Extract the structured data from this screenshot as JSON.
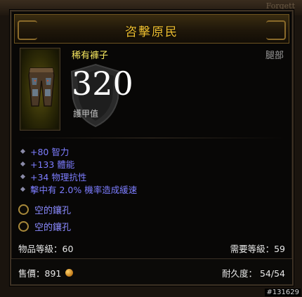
{
  "background": {
    "corner_text": "Forgett"
  },
  "tooltip": {
    "title": "咨擊原民",
    "item_name": "稀有褲子",
    "slot": "腿部",
    "armor_value": "320",
    "armor_label": "護甲值",
    "stats": [
      "+80 智力",
      "+133 體能",
      "+34 物理抗性",
      "擊中有 2.0% 機率造成緩速"
    ],
    "sockets": [
      "空的鑲孔",
      "空的鑲孔"
    ],
    "item_level": "物品等級：60",
    "required_level": "需要等級：59",
    "sell_price": "售價：891",
    "durability": "耐久度： 54/54",
    "colors": {
      "title": "#f0c030",
      "item_name": "#f8e860",
      "stat": "#7d7dff",
      "socket_text": "#8a8aff"
    }
  },
  "watermark": "#131629"
}
